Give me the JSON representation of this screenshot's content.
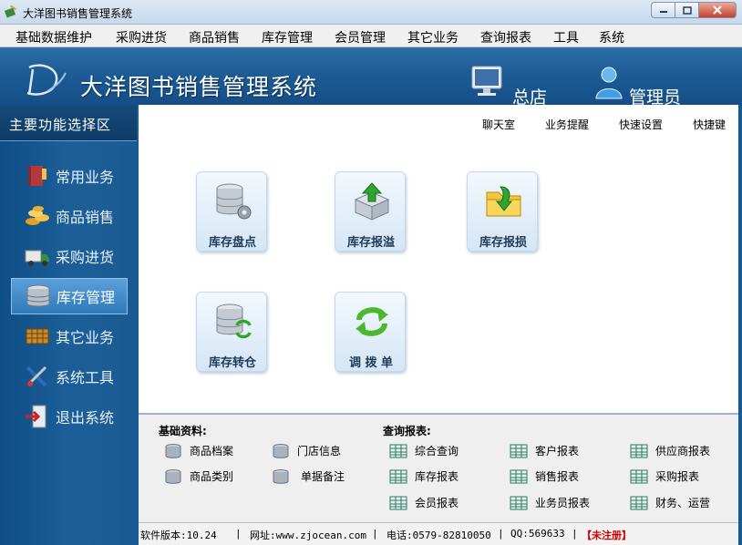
{
  "window": {
    "title": "大洋图书销售管理系统",
    "app_icon": "book-pen-icon",
    "controls": {
      "minimize": "minimize-icon",
      "maximize": "maximize-icon",
      "close": "close-icon"
    }
  },
  "menu": {
    "items": [
      "基础数据维护",
      "采购进货",
      "商品销售",
      "库存管理",
      "会员管理",
      "其它业务",
      "查询报表",
      "工具",
      "系统"
    ]
  },
  "header": {
    "logo_icon": "dy-logo-icon",
    "system_title": "大洋图书销售管理系统",
    "store_icon": "monitor-icon",
    "store_label": "总店",
    "role_icon": "user-icon",
    "role_label": "管理员"
  },
  "sidebar": {
    "title": "主要功能选择区",
    "items": [
      {
        "label": "常用业务",
        "icon": "book-icon",
        "active": false
      },
      {
        "label": "商品销售",
        "icon": "coins-icon",
        "active": false
      },
      {
        "label": "采购进货",
        "icon": "truck-icon",
        "active": false
      },
      {
        "label": "库存管理",
        "icon": "database-icon",
        "active": true
      },
      {
        "label": "其它业务",
        "icon": "grid-icon",
        "active": false
      },
      {
        "label": "系统工具",
        "icon": "tools-icon",
        "active": false
      },
      {
        "label": "退出系统",
        "icon": "exit-icon",
        "active": false
      }
    ]
  },
  "quicklinks": [
    "聊天室",
    "业务提醒",
    "快速设置",
    "快捷键"
  ],
  "tiles": [
    {
      "label": "库存盘点",
      "icon": "database-gear-icon"
    },
    {
      "label": "库存报溢",
      "icon": "box-upload-icon"
    },
    {
      "label": "库存报损",
      "icon": "folder-download-icon"
    },
    {
      "label": "库存转仓",
      "icon": "database-sync-icon"
    },
    {
      "label": "调 拨 单",
      "icon": "sync-arrows-icon"
    }
  ],
  "basic_data": {
    "title": "基础资料:",
    "items": [
      "商品档案",
      "门店信息",
      "商品类别",
      "单据备注"
    ]
  },
  "reports": {
    "title": "查询报表:",
    "items": [
      "综合查询",
      "客户报表",
      "供应商报表",
      "库存报表",
      "销售报表",
      "采购报表",
      "会员报表",
      "业务员报表",
      "财务、运营"
    ]
  },
  "status": {
    "version": "软件版本:10.24",
    "website": "网址:www.zjocean.com",
    "phone": "电话:0579-82810050",
    "qq": "QQ:569633",
    "registration": "【未注册】",
    "separator": "|"
  },
  "colors": {
    "banner": "#1e5d97",
    "sidebar": "#1a5a92",
    "active_item": "#3f8acb",
    "unregistered": "#d10000"
  }
}
